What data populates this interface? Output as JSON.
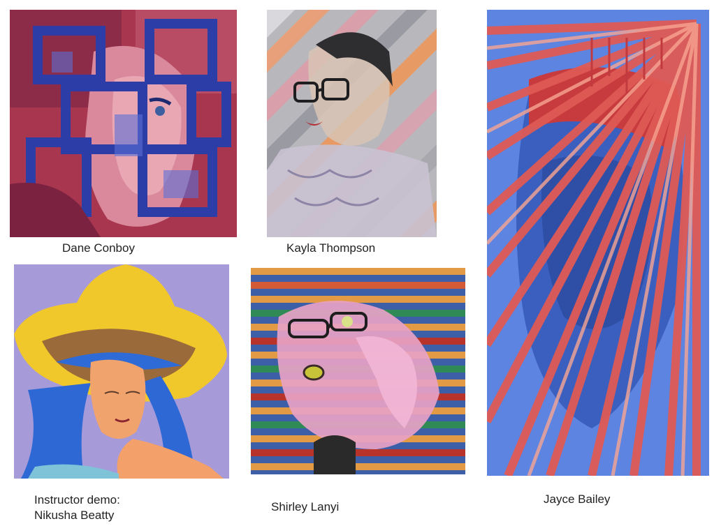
{
  "artworks": [
    {
      "id": "dane-conboy",
      "caption": "Dane Conboy",
      "subject": "portrait of a man overlaid with blue and red geometric rectangles",
      "palette": [
        "#b5415a",
        "#2b3ea8",
        "#7e2a4a",
        "#d98aa0"
      ]
    },
    {
      "id": "kayla-thompson",
      "caption": "Kayla Thompson",
      "subject": "graphite portrait of a young woman with glasses, crossed by pink, orange and grey diagonal stripes",
      "palette": [
        "#cfcfd3",
        "#3a3a3a",
        "#e89a6a",
        "#d89aa8"
      ]
    },
    {
      "id": "nikusha-beatty",
      "caption_line1": "Instructor demo:",
      "caption_line2": "Nikusha Beatty",
      "subject": "woman with blue hair wearing a large yellow hat on lavender background",
      "palette": [
        "#a99ad6",
        "#f0c62b",
        "#2d6fd6",
        "#e8915a"
      ]
    },
    {
      "id": "shirley-lanyi",
      "caption": "Shirley Lanyi",
      "subject": "surprised face with glasses behind a hand, with horizontal multicolor stripes",
      "palette": [
        "#e39a45",
        "#3b5fa8",
        "#2f8a56",
        "#e8a6c8"
      ]
    },
    {
      "id": "jayce-bailey",
      "caption": "Jayce Bailey",
      "subject": "blue figure under radiating red diagonal stripes and dripping red paint",
      "palette": [
        "#3f6fd0",
        "#e05a55",
        "#f59a8a",
        "#2a3f8a"
      ]
    }
  ]
}
